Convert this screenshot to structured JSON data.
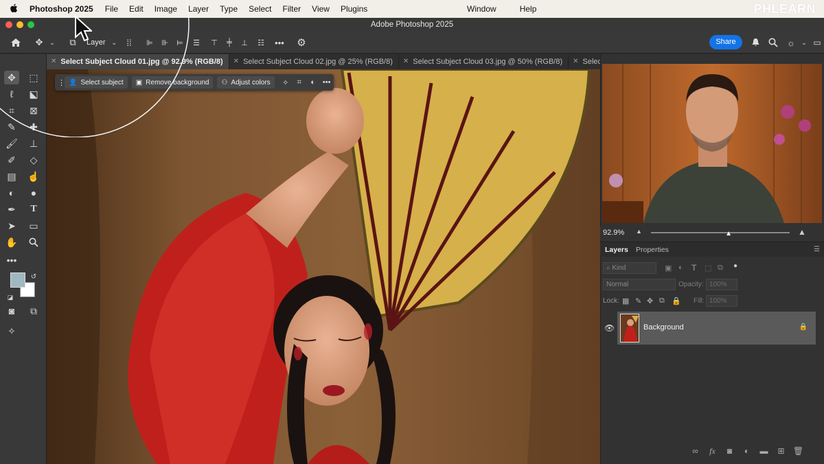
{
  "menubar": {
    "apple_icon": "apple-icon",
    "app_name": "Photoshop 2025",
    "items": [
      "File",
      "Edit",
      "Image",
      "Layer",
      "Type",
      "Select",
      "Filter",
      "View",
      "Plugins"
    ],
    "right_items": [
      "Window",
      "Help"
    ],
    "watermark": "PHLEARN"
  },
  "window": {
    "title": "Adobe Photoshop 2025"
  },
  "options_bar": {
    "layer_select": "Layer",
    "share_label": "Share",
    "icons": [
      "home-icon",
      "move-icon",
      "stack-icon",
      "align-icons",
      "more-icon",
      "gear-icon",
      "bell-icon",
      "search-icon",
      "lightbulb-icon",
      "panels-icon"
    ]
  },
  "tabs": [
    {
      "label": "Select Subject Cloud 01.jpg @ 92.9% (RGB/8)",
      "active": true
    },
    {
      "label": "Select Subject Cloud 02.jpg @ 25% (RGB/8)",
      "active": false
    },
    {
      "label": "Select Subject Cloud 03.jpg @ 50% (RGB/8)",
      "active": false
    },
    {
      "label": "Select Subje",
      "active": false
    }
  ],
  "contextual_taskbar": {
    "select_subject": "Select subject",
    "remove_background": "Remove background",
    "adjust_colors": "Adjust colors"
  },
  "colors": {
    "foreground": "#9fb8c1",
    "background": "#ffffff",
    "accent": "#1473e6"
  },
  "navigator": {
    "zoom": "92.9%",
    "zoom_fraction": 0.56
  },
  "layers_panel": {
    "tabs": [
      "Layers",
      "Properties"
    ],
    "kind_placeholder": "Kind",
    "blend_mode": "Normal",
    "opacity_label": "Opacity:",
    "opacity_value": "100%",
    "lock_label": "Lock:",
    "fill_label": "Fill:",
    "fill_value": "100%",
    "layers": [
      {
        "name": "Background",
        "visible": true,
        "locked": true
      }
    ]
  }
}
